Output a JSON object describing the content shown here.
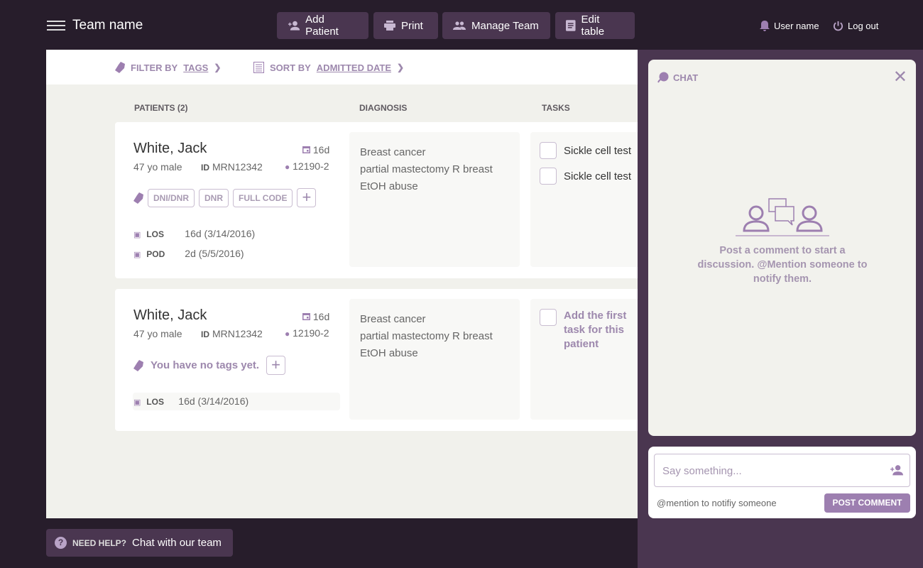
{
  "header": {
    "team_name": "Team name",
    "buttons": [
      {
        "label": "Add Patient",
        "icon": "add-person-icon"
      },
      {
        "label": "Print",
        "icon": "printer-icon"
      },
      {
        "label": "Manage Team",
        "icon": "group-icon"
      },
      {
        "label": "Edit table",
        "icon": "document-icon"
      }
    ],
    "user_name": "User name",
    "logout": "Log out"
  },
  "filters": {
    "filter_prefix": "FILTER BY",
    "filter_value": "TAGS",
    "sort_prefix": "SORT BY",
    "sort_value": "ADMITTED DATE"
  },
  "columns": {
    "patients": "PATIENTS (2)",
    "diagnosis": "DIAGNOSIS",
    "tasks": "TASKS"
  },
  "patients": [
    {
      "name": "White, Jack",
      "age_sex": "47 yo male",
      "id_label": "ID",
      "id": "MRN12342",
      "days": "16d",
      "location": "12190-2",
      "tags": [
        "DNI/DNR",
        "DNR",
        "FULL CODE"
      ],
      "los_label": "LOS",
      "los": "16d (3/14/2016)",
      "pod_label": "POD",
      "pod": "2d (5/5/2016)",
      "diagnosis": [
        "Breast cancer",
        "partial mastectomy R breast",
        "EtOH abuse"
      ],
      "tasks": [
        "Sickle cell test",
        "Sickle cell test"
      ]
    },
    {
      "name": "White, Jack",
      "age_sex": "47 yo male",
      "id_label": "ID",
      "id": "MRN12342",
      "days": "16d",
      "location": "12190-2",
      "no_tags": "You have no tags yet.",
      "los_label": "LOS",
      "los": "16d (3/14/2016)",
      "diagnosis": [
        "Breast cancer",
        "partial mastectomy R breast",
        "EtOH abuse"
      ],
      "task_placeholder": "Add the first task for this patient"
    }
  ],
  "chat": {
    "title": "CHAT",
    "empty_message": "Post a comment to start a discussion. @Mention someone to notify them.",
    "input_placeholder": "Say something...",
    "hint": "@mention to notifiy someone",
    "post_button": "POST COMMENT"
  },
  "help": {
    "label": "NEED HELP?",
    "link": "Chat with our team"
  },
  "colors": {
    "accent": "#9d7fb0",
    "topbar": "#271d2b",
    "panel": "#4a3650"
  }
}
